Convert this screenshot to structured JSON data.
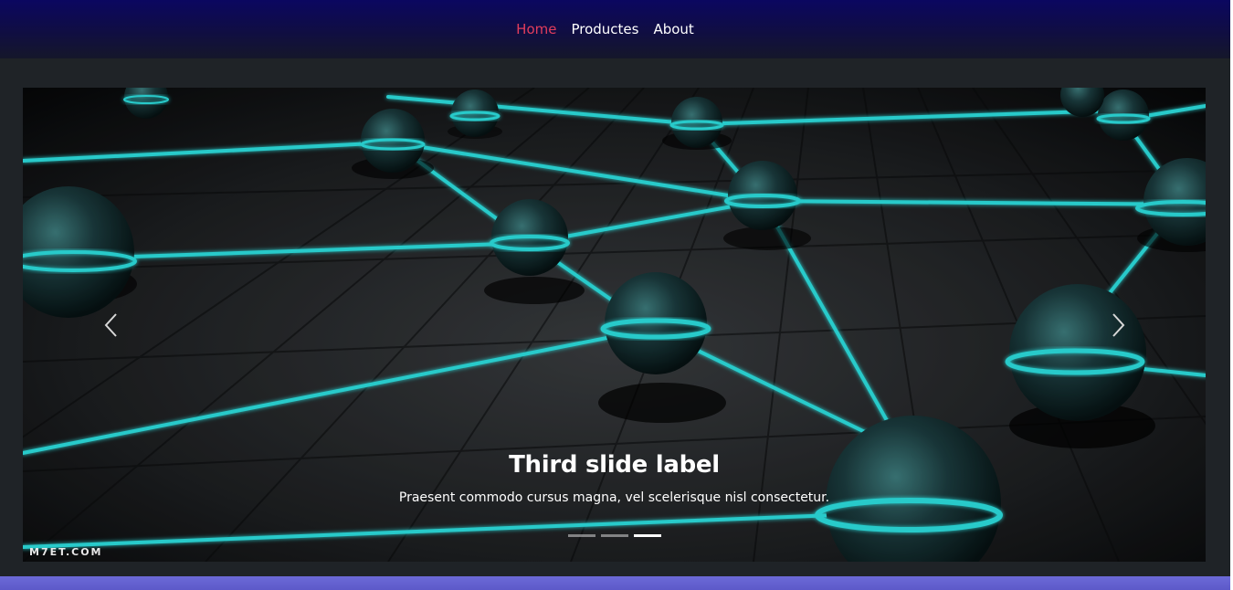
{
  "navbar": {
    "links": [
      {
        "label": "Home",
        "active": true
      },
      {
        "label": "Productes",
        "active": false
      },
      {
        "label": "About",
        "active": false
      }
    ],
    "active_color": "#e23d5c"
  },
  "carousel": {
    "slide_image": "network-spheres-image",
    "caption_title": "Third slide label",
    "caption_text": "Praesent commodo cursus magna, vel scelerisque nisl consectetur.",
    "watermark": "M7ET.COM",
    "slide_count": 3,
    "active_slide": 3,
    "prev_icon": "chevron-left-icon",
    "next_icon": "chevron-right-icon",
    "glow_color": "#2ee6e6"
  },
  "colors": {
    "page_bg": "#1f2327",
    "navbar_top": "#0b0760",
    "bottom_bar": "#6c6ad8"
  }
}
